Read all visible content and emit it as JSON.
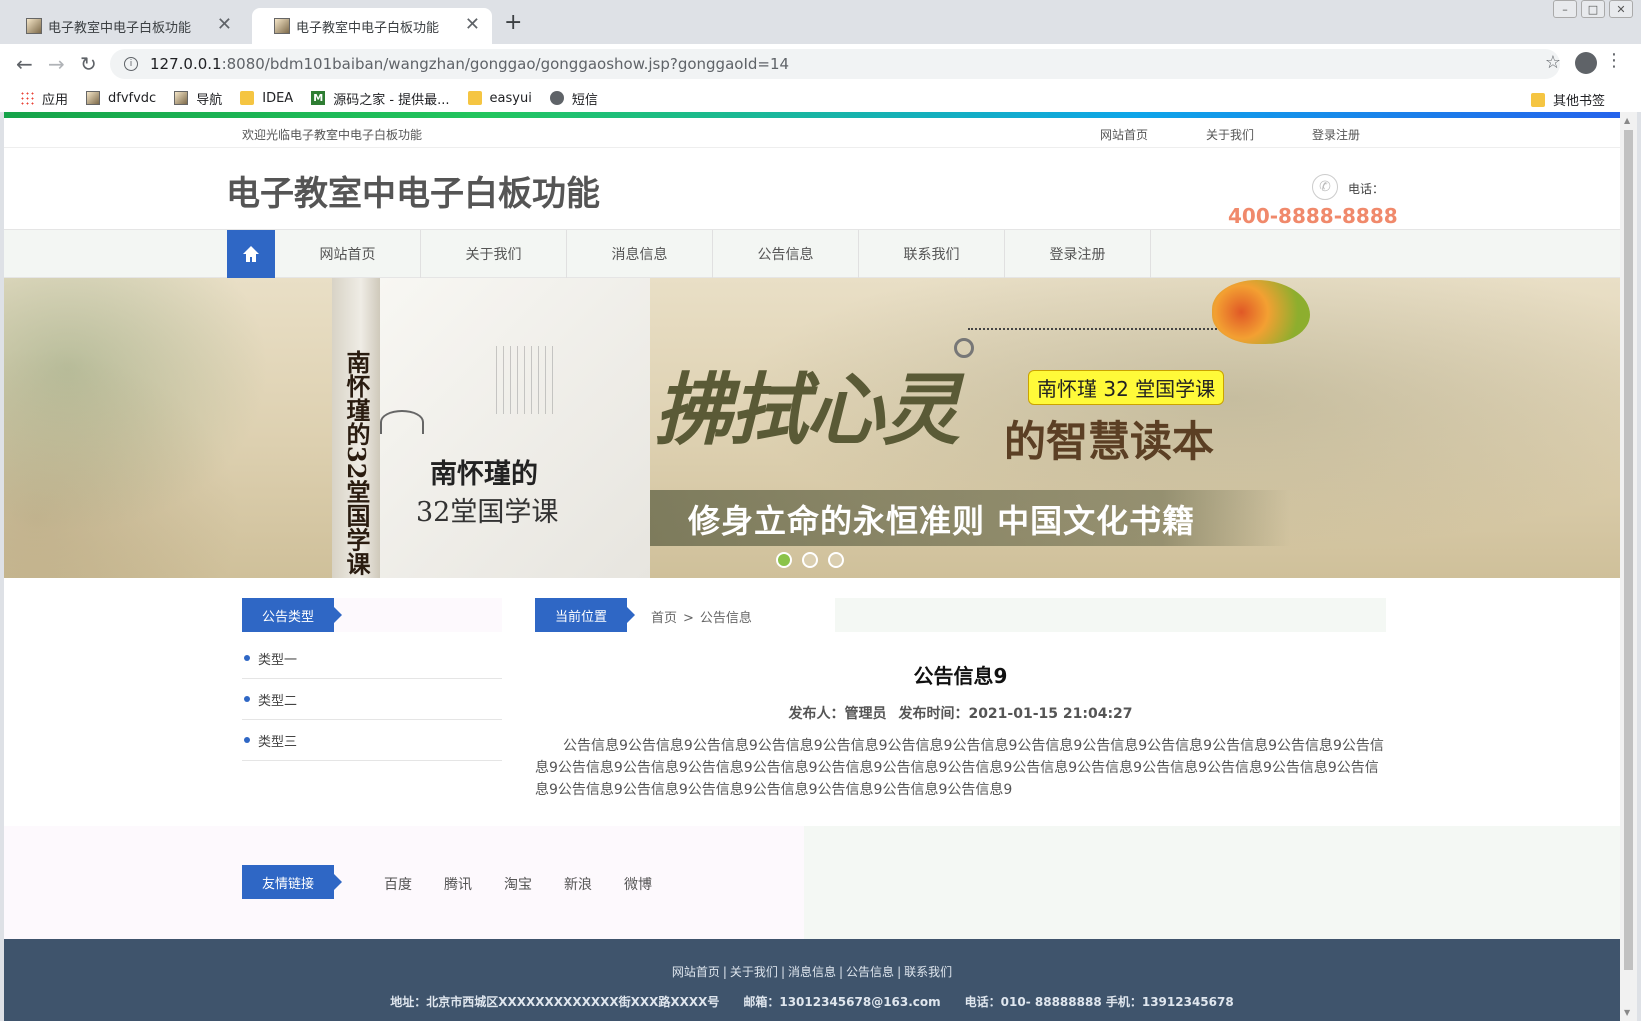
{
  "browser": {
    "tabs": [
      {
        "title": "电子教室中电子白板功能",
        "active": false
      },
      {
        "title": "电子教室中电子白板功能",
        "active": true
      }
    ],
    "url_host": "127.0.0.1",
    "url_path": ":8080/bdm101baiban/wangzhan/gonggao/gonggaoshow.jsp?gonggaoId=14",
    "bookmarks": [
      "应用",
      "dfvfvdc",
      "导航",
      "IDEA",
      "源码之家 - 提供最...",
      "easyui",
      "短信"
    ],
    "bookmark_other": "其他书签"
  },
  "site": {
    "welcome": "欢迎光临电子教室中电子白板功能",
    "top_links": [
      "网站首页",
      "关于我们",
      "登录注册"
    ],
    "title": "电子教室中电子白板功能",
    "phone_label": "电话：",
    "phone_number": "400-8888-8888",
    "nav": [
      "网站首页",
      "关于我们",
      "消息信息",
      "公告信息",
      "联系我们",
      "登录注册"
    ]
  },
  "banner": {
    "spine_text": "南怀瑾的32堂国学课",
    "book_title_line1": "南怀瑾的",
    "book_title_line2": "32堂国学课",
    "calligraphy": "拂拭心灵",
    "pill": "南怀瑾 32 堂国学课",
    "subtitle": "的智慧读本",
    "tagline": "修身立命的永恒准则 中国文化书籍",
    "dots_active": 0
  },
  "sidebar": {
    "heading": "公告类型",
    "items": [
      "类型一",
      "类型二",
      "类型三"
    ]
  },
  "main": {
    "location_label": "当前位置",
    "crumb_home": "首页",
    "crumb_sep": ">",
    "crumb_current": "公告信息",
    "title": "公告信息9",
    "publisher": "发布人：管理员",
    "publish_time": "发布时间：2021-01-15 21:04:27",
    "body": "公告信息9公告信息9公告信息9公告信息9公告信息9公告信息9公告信息9公告信息9公告信息9公告信息9公告信息9公告信息9公告信息9公告信息9公告信息9公告信息9公告信息9公告信息9公告信息9公告信息9公告信息9公告信息9公告信息9公告信息9公告信息9公告信息9公告信息9公告信息9公告信息9公告信息9公告信息9公告信息9公告信息9"
  },
  "friends": {
    "heading": "友情链接",
    "links": [
      "百度",
      "腾讯",
      "淘宝",
      "新浪",
      "微博"
    ]
  },
  "footer": {
    "links": [
      "网站首页",
      "关于我们",
      "消息信息",
      "公告信息",
      "联系我们"
    ],
    "address": "地址：北京市西城区XXXXXXXXXXXXX街XXX路XXXX号",
    "email": "邮箱：13012345678@163.com",
    "phone": "电话：010- 88888888 手机：13912345678"
  },
  "colors": {
    "primary": "#2f67c5",
    "phone": "#f0896b",
    "footer_bg": "#3f546c"
  }
}
